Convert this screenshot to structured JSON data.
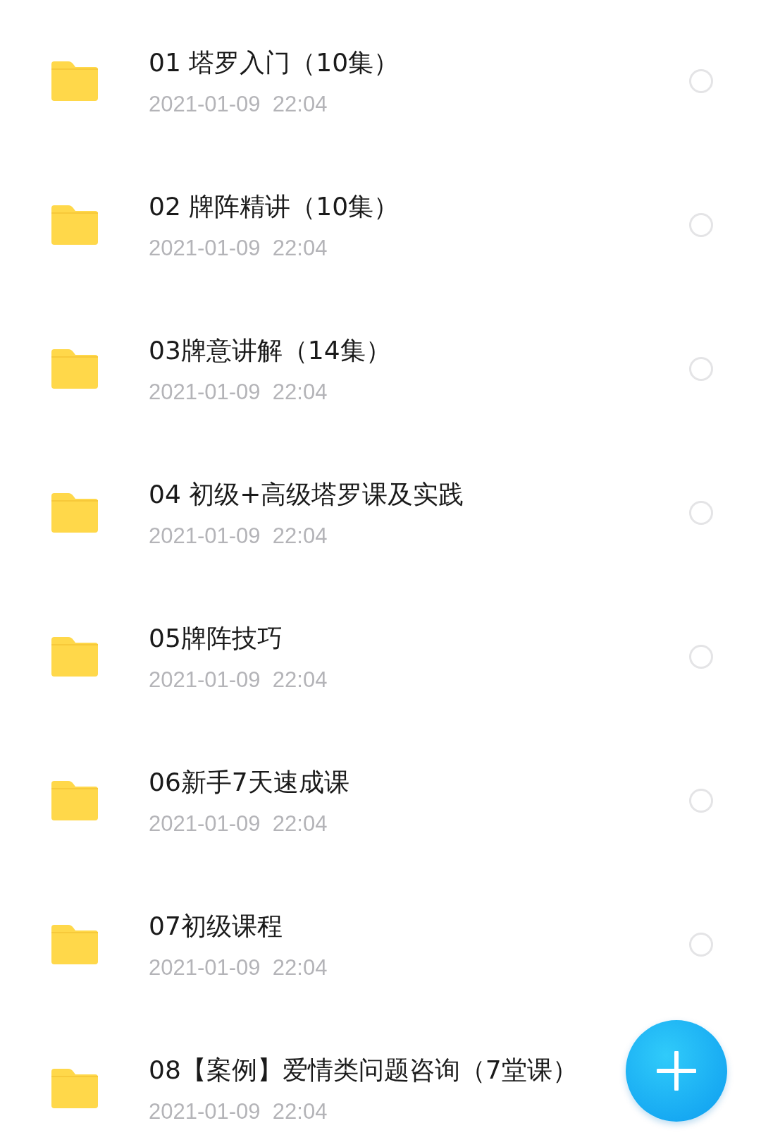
{
  "files": [
    {
      "name": "01 塔罗入门（10集）",
      "date": "2021-01-09  22:04",
      "selected": false
    },
    {
      "name": "02 牌阵精讲（10集）",
      "date": "2021-01-09  22:04",
      "selected": false
    },
    {
      "name": "03牌意讲解（14集）",
      "date": "2021-01-09  22:04",
      "selected": false
    },
    {
      "name": "04 初级+高级塔罗课及实践",
      "date": "2021-01-09  22:04",
      "selected": false
    },
    {
      "name": "05牌阵技巧",
      "date": "2021-01-09  22:04",
      "selected": false
    },
    {
      "name": "06新手7天速成课",
      "date": "2021-01-09  22:04",
      "selected": false
    },
    {
      "name": "07初级课程",
      "date": "2021-01-09  22:04",
      "selected": false
    },
    {
      "name": "08【案例】爱情类问题咨询（7堂课）",
      "date": "2021-01-09  22:04"
    }
  ]
}
